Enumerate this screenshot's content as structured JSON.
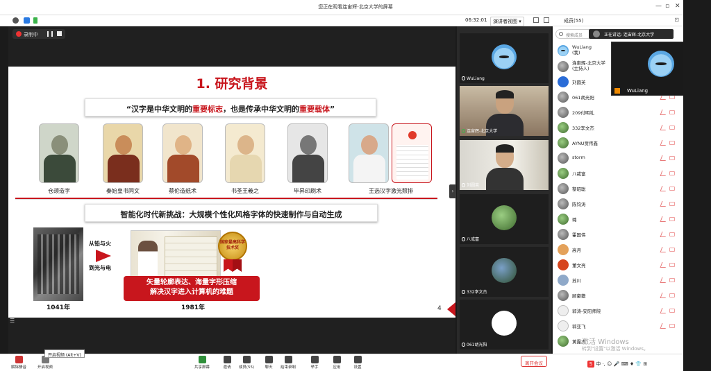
{
  "window": {
    "title": "您正在观看连宙辉-北京大学的屏幕"
  },
  "toolbar": {
    "timer": "06:32:01",
    "view_label": "演讲者视图 ▾"
  },
  "members_panel": {
    "header": "成员(55)",
    "search_placeholder": "搜索成员",
    "speaking_label": "正在讲话: 连宙辉-北京大学",
    "members": [
      {
        "name": "WuLiang",
        "role": "(我)"
      },
      {
        "name": "连宙辉-北京大学",
        "role": "(主持人)"
      },
      {
        "name": "刘圆英",
        "role": ""
      },
      {
        "name": "061胡光阳",
        "role": ""
      },
      {
        "name": "209付明礼",
        "role": ""
      },
      {
        "name": "332李文杰",
        "role": ""
      },
      {
        "name": "AYNU贾伟鑫",
        "role": ""
      },
      {
        "name": "storm",
        "role": ""
      },
      {
        "name": "八戒富",
        "role": ""
      },
      {
        "name": "黎昭聪",
        "role": ""
      },
      {
        "name": "陈钧涛",
        "role": ""
      },
      {
        "name": "璐",
        "role": ""
      },
      {
        "name": "霍国伟",
        "role": ""
      },
      {
        "name": "高月",
        "role": ""
      },
      {
        "name": "董文亮",
        "role": ""
      },
      {
        "name": "苏川",
        "role": ""
      },
      {
        "name": "顾豪籍",
        "role": ""
      },
      {
        "name": "郭涛-安阳师院",
        "role": ""
      },
      {
        "name": "郭亚飞",
        "role": ""
      },
      {
        "name": "黄露杰",
        "role": ""
      }
    ]
  },
  "recording": {
    "label": "录制中"
  },
  "slide": {
    "title": "1. 研究背景",
    "quote_pre": "“汉字是中华文明的",
    "quote_hi1": "重要标志",
    "quote_mid": "，也是传承中华文明的",
    "quote_hi2": "重要载体",
    "quote_post": "”",
    "captions": [
      "仓颉造字",
      "秦始皇书同文",
      "蔡伦造纸术",
      "书圣王羲之",
      "毕昇印刷术",
      "王选汉字激光照排"
    ],
    "challenge": "智能化时代新挑战：大规模个性化风格字体的快速制作与自动生成",
    "from_lead": "从铅与火",
    "to_light": "到光与电",
    "year1": "1041年",
    "year2": "1981年",
    "medal_text": "国家最高科学技术奖",
    "red_line1": "矢量轮廓表达、海量字形压缩",
    "red_line2": "解决汉字进入计算机的难题",
    "page_number": "4"
  },
  "videos": [
    {
      "name": "WuLiang"
    },
    {
      "name": "连宙辉-北京大学"
    },
    {
      "name": "刘圆英"
    },
    {
      "name": "八戒富"
    },
    {
      "name": "332李文杰"
    },
    {
      "name": "061胡光阳"
    }
  ],
  "selfview": {
    "name": "WuLiang"
  },
  "bottombar": {
    "unmute": "解除静音",
    "video": "开启视频",
    "tooltip": "开启视频 (Alt+V)",
    "share": "共享屏幕",
    "invite": "邀请",
    "members": "成员(55)",
    "chat": "聊天",
    "record": "结束录制",
    "raise_hand": "举手",
    "apps": "应用",
    "settings": "设置",
    "leave": "离开会议"
  },
  "windows_watermark": {
    "line1": "激活 Windows",
    "line2": "转到\"设置\"以激活 Windows。"
  },
  "ime": {
    "label": "中 ·, ☺ 🎤 ⌨ ♦ 👕 ⊞"
  }
}
